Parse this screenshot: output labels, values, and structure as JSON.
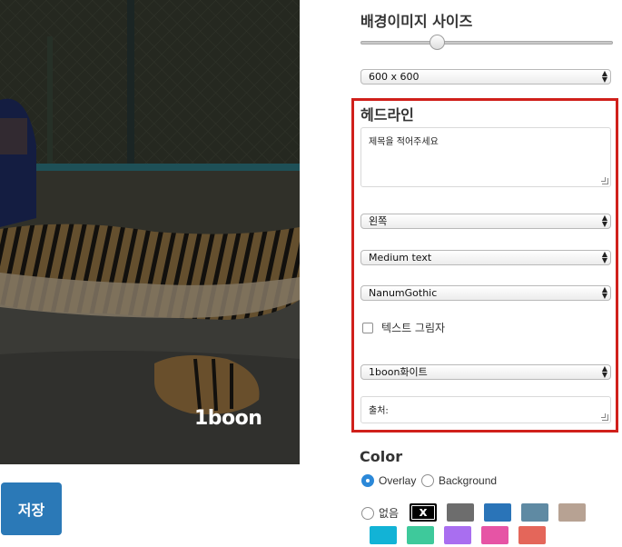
{
  "preview": {
    "logo_text": "1boon"
  },
  "save_button": {
    "label": "저장"
  },
  "bg_size": {
    "title": "배경이미지 사이즈",
    "slider_value": 0.29,
    "select_value": "600 x 600"
  },
  "headline": {
    "title": "헤드라인",
    "textarea_placeholder": "제목을 적어주세요",
    "align_value": "왼쪽",
    "size_value": "Medium text",
    "font_value": "NanumGothic",
    "shadow_label": "텍스트 그림자",
    "shadow_checked": false,
    "style_value": "1boon화이트",
    "source_placeholder": "출처:"
  },
  "color": {
    "title": "Color",
    "overlay_label": "Overlay",
    "background_label": "Background",
    "selected_mode": "Overlay",
    "none_label": "없음",
    "x_label": "x",
    "swatches_row1": [
      "#000000",
      "#6d6d6d",
      "#2a74b8",
      "#5f8aa3",
      "#b7a293"
    ],
    "swatches_row2": [
      "#12b3d6",
      "#3ec99b",
      "#a96ef0",
      "#e654a5",
      "#e4665a"
    ]
  }
}
